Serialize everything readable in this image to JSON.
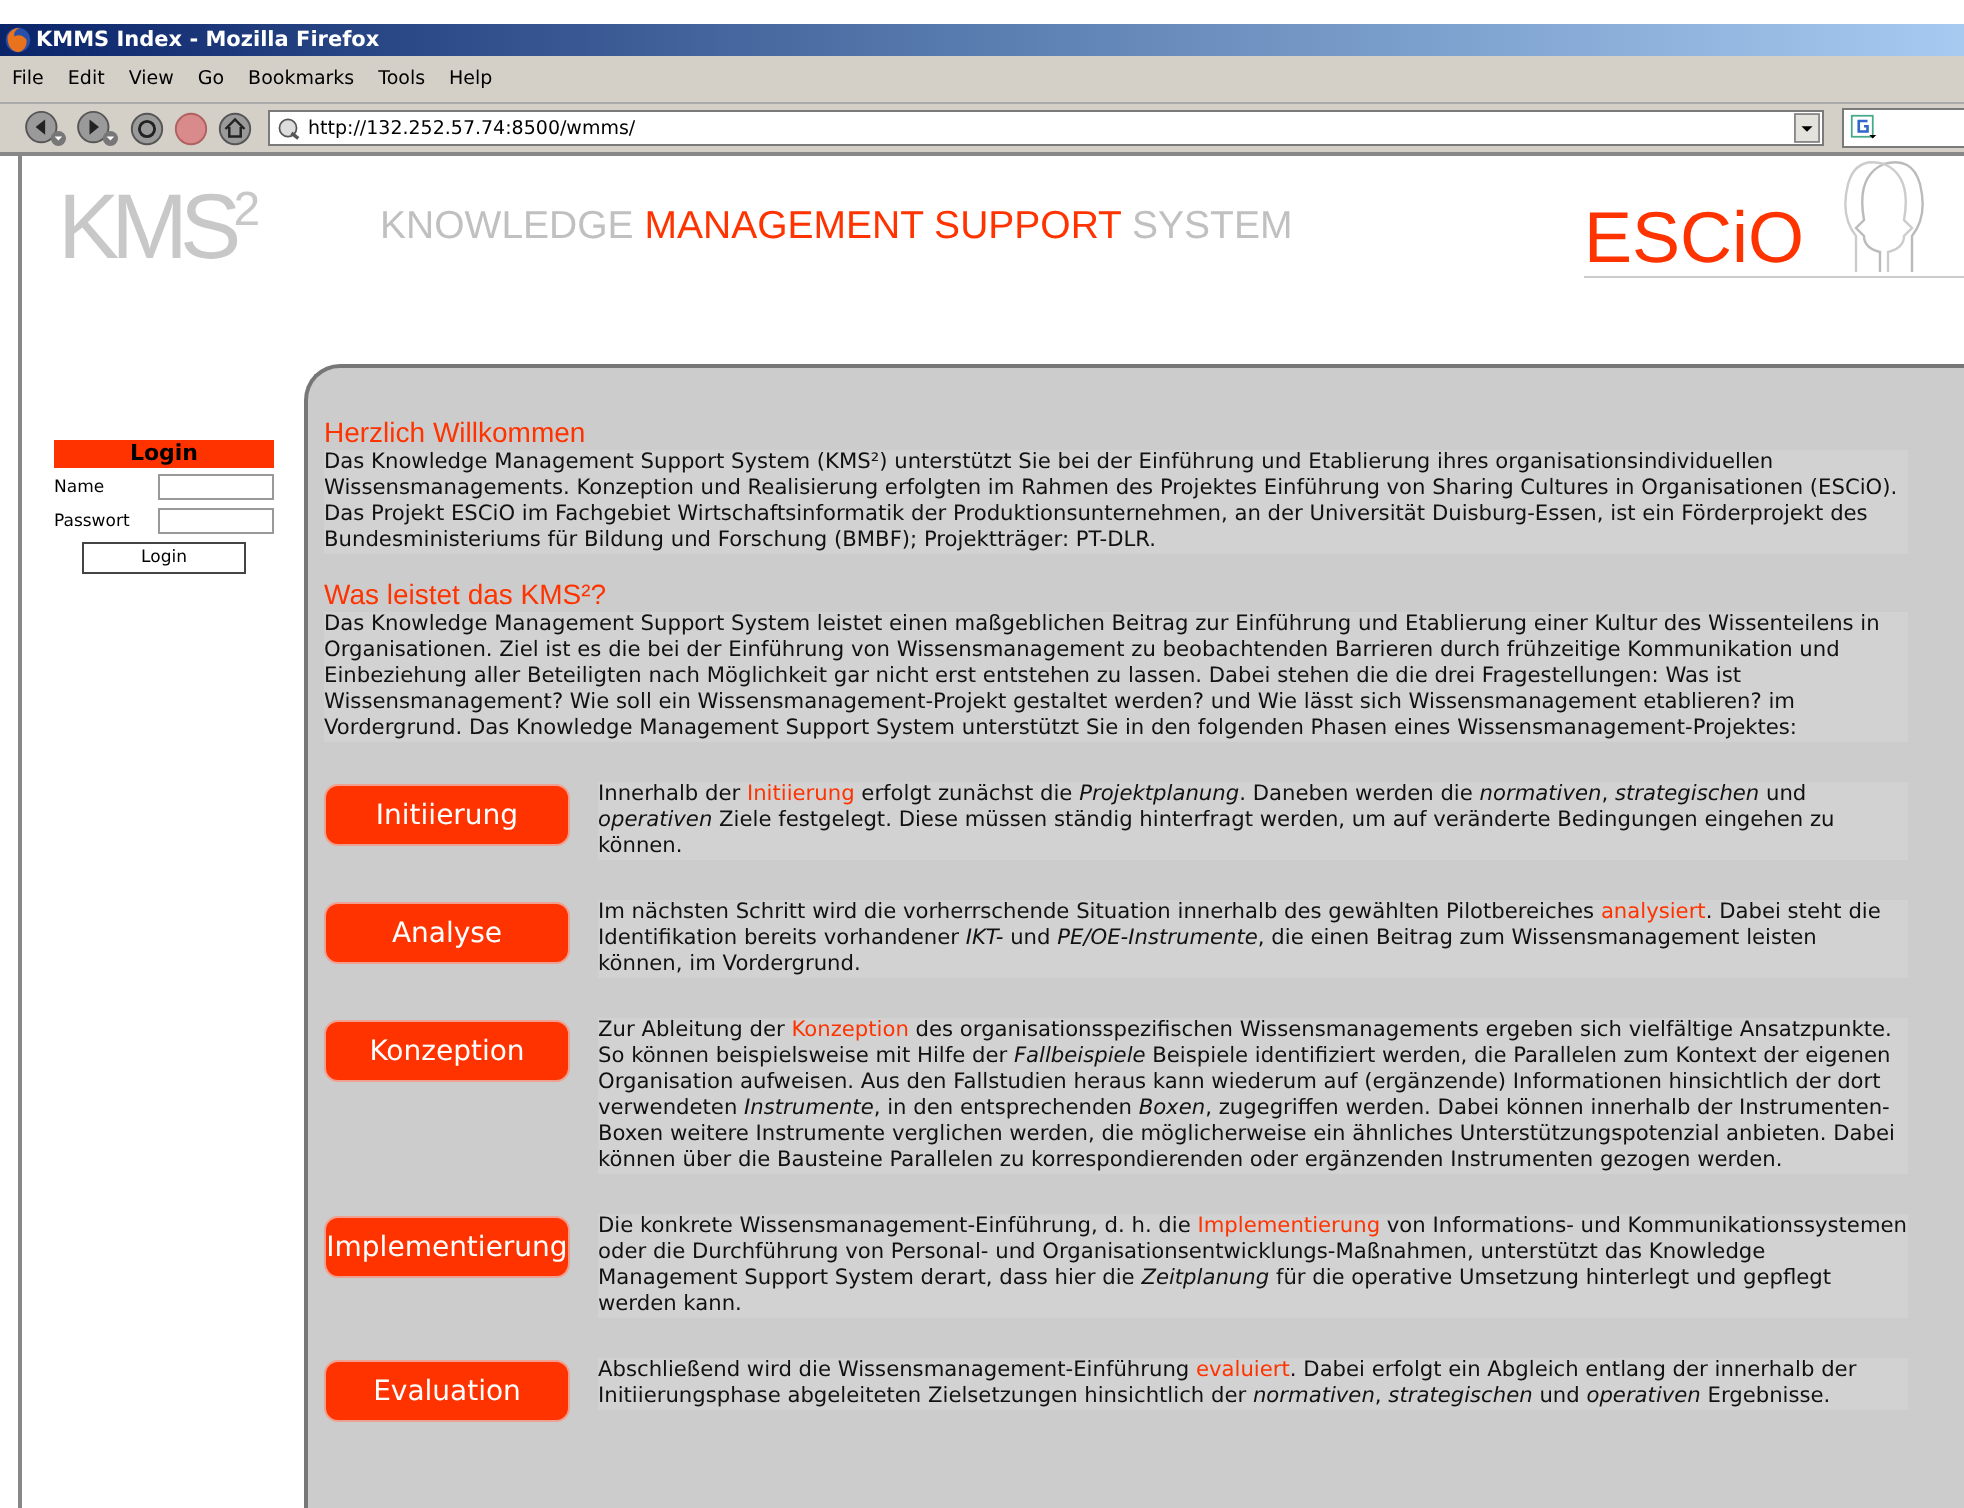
{
  "window": {
    "title": "KMMS Index - Mozilla Firefox"
  },
  "menu": [
    "File",
    "Edit",
    "View",
    "Go",
    "Bookmarks",
    "Tools",
    "Help"
  ],
  "address": {
    "value": "http://132.252.57.74:8500/wmms/"
  },
  "header": {
    "logo": "KMS$^{2}$",
    "title": [
      {
        "text": "KNOWLEDGE ",
        "accent": false
      },
      {
        "text": "MANAGEMENT SUPPORT",
        "accent": true
      },
      {
        "text": " SYSTEM",
        "accent": false
      }
    ],
    "partner_logo": "ESCiO"
  },
  "login": {
    "title": "Login",
    "fields": [
      {
        "label": "Name"
      },
      {
        "label": "Passwort"
      }
    ],
    "button": "Login"
  },
  "sections": [
    {
      "heading": "Herzlich Willkommen",
      "text": "Das Knowledge Management Support System (KMS²) unterstützt Sie bei der Einführung und Etablierung ihres organisationsindividuellen Wissensmanagements. Konzeption und Realisierung erfolgten im Rahmen des Projektes Einführung von Sharing Cultures in Organisationen (ESCiO). Das Projekt ESCiO im Fachgebiet Wirtschaftsinformatik der Produktionsunternehmen, an der Universität Duisburg-Essen, ist ein Förderprojekt des Bundesministeriums für Bildung und Forschung (BMBF); Projektträger: PT-DLR."
    },
    {
      "heading": "Was leistet das KMS²?",
      "text": "Das Knowledge Management Support System leistet einen maßgeblichen Beitrag zur Einführung und Etablierung einer Kultur des Wissenteilens in Organisationen. Ziel ist es die bei der Einführung von Wissensmanagement zu beobachtenden Barrieren durch frühzeitige Kommunikation und Einbeziehung aller Beteiligten nach Möglichkeit gar nicht erst entstehen zu lassen. Dabei stehen die die drei Fragestellungen: Was ist Wissensmanagement? Wie soll ein Wissensmanagement-Projekt gestaltet werden? und Wie lässt sich Wissensmanagement etablieren? im Vordergrund. Das Knowledge Management Support System unterstützt Sie in den folgenden Phasen eines Wissensmanagement-Projektes:"
    }
  ],
  "phases": [
    {
      "button": "Initiierung",
      "parts": [
        {
          "kind": "text",
          "text": "Innerhalb der "
        },
        {
          "kind": "link",
          "text": "Initiierung"
        },
        {
          "kind": "text",
          "text": " erfolgt zunächst die *Projektplanung*. Daneben werden die *normativen*, *strategischen* und *operativen* Ziele festgelegt. Diese müssen ständig hinterfragt werden, um auf veränderte Bedingungen eingehen zu können."
        }
      ]
    },
    {
      "button": "Analyse",
      "parts": [
        {
          "kind": "text",
          "text": "Im nächsten Schritt wird die vorherrschende Situation innerhalb des gewählten Pilotbereiches "
        },
        {
          "kind": "link",
          "text": "analysiert"
        },
        {
          "kind": "text",
          "text": ". Dabei steht die Identifikation bereits vorhandener *IKT-* und *PE/OE-Instrumente*, die einen Beitrag zum Wissensmanagement leisten können, im Vordergrund."
        }
      ]
    },
    {
      "button": "Konzeption",
      "parts": [
        {
          "kind": "text",
          "text": "Zur Ableitung der "
        },
        {
          "kind": "link",
          "text": "Konzeption"
        },
        {
          "kind": "text",
          "text": " des organisationsspezifischen Wissensmanagements ergeben sich vielfältige Ansatzpunkte. So können beispielsweise mit Hilfe der *Fallbeispiele* Beispiele identifiziert werden, die Parallelen zum Kontext der eigenen Organisation aufweisen. Aus den Fallstudien heraus kann wiederum auf (ergänzende) Informationen hinsichtlich der dort verwendeten *Instrumente*, in den entsprechenden *Boxen*, zugegriffen werden. Dabei können innerhalb der Instrumenten-Boxen weitere Instrumente verglichen werden, die möglicherweise ein ähnliches Unterstützungspotenzial anbieten. Dabei können über die Bausteine Parallelen zu korrespondierenden oder ergänzenden Instrumenten gezogen werden."
        }
      ]
    },
    {
      "button": "Implementierung",
      "parts": [
        {
          "kind": "text",
          "text": "Die konkrete Wissensmanagement-Einführung, d. h. die "
        },
        {
          "kind": "link",
          "text": "Implementierung"
        },
        {
          "kind": "text",
          "text": " von Informations- und Kommunikationssystemen oder die Durchführung von Personal- und Organisationsentwicklungs-Maßnahmen, unterstützt das Knowledge Management Support System derart, dass hier die *Zeitplanung* für die operative Umsetzung hinterlegt und gepflegt werden kann."
        }
      ]
    },
    {
      "button": "Evaluation",
      "parts": [
        {
          "kind": "text",
          "text": "Abschließend wird die Wissensmanagement-Einführung "
        },
        {
          "kind": "link",
          "text": "evaluiert"
        },
        {
          "kind": "text",
          "text": ". Dabei erfolgt ein Abgleich entlang der innerhalb der Initiierungsphase abgeleiteten Zielsetzungen hinsichtlich der *normativen*, *strategischen* und *operativen* Ergebnisse."
        }
      ]
    }
  ]
}
